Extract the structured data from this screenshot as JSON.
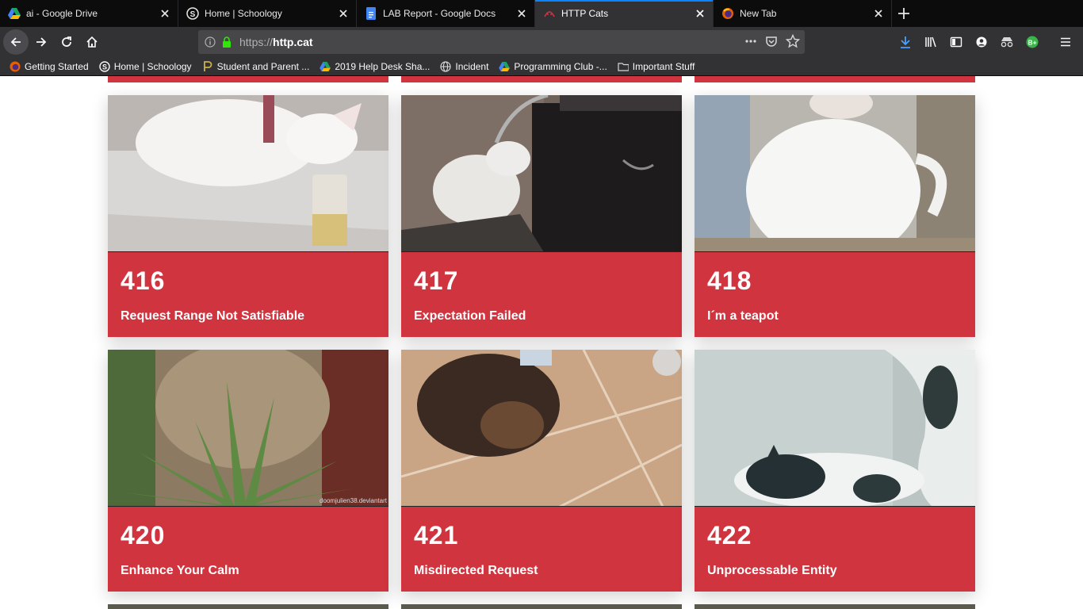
{
  "tabs": [
    {
      "title": "ai - Google Drive",
      "icon": "google-drive-icon"
    },
    {
      "title": "Home | Schoology",
      "icon": "schoology-icon"
    },
    {
      "title": "LAB Report - Google Docs",
      "icon": "google-docs-icon"
    },
    {
      "title": "HTTP Cats",
      "icon": "http-cats-icon",
      "active": true
    },
    {
      "title": "New Tab",
      "icon": "firefox-icon"
    }
  ],
  "urlbar": {
    "protocol": "https://",
    "host": "http.cat"
  },
  "bookmarks": [
    {
      "label": "Getting Started",
      "icon": "firefox-icon"
    },
    {
      "label": "Home | Schoology",
      "icon": "schoology-icon"
    },
    {
      "label": "Student and Parent ...",
      "icon": "p-logo-icon"
    },
    {
      "label": "2019 Help Desk Sha...",
      "icon": "google-drive-icon"
    },
    {
      "label": "Incident",
      "icon": "globe-icon"
    },
    {
      "label": "Programming Club -...",
      "icon": "google-drive-icon"
    },
    {
      "label": "Important Stuff",
      "icon": "folder-icon"
    }
  ],
  "cards": [
    {
      "code": "416",
      "desc": "Request Range Not Satisfiable"
    },
    {
      "code": "417",
      "desc": "Expectation Failed"
    },
    {
      "code": "418",
      "desc": "I´m a teapot"
    },
    {
      "code": "420",
      "desc": "Enhance Your Calm"
    },
    {
      "code": "421",
      "desc": "Misdirected Request"
    },
    {
      "code": "422",
      "desc": "Unprocessable Entity"
    }
  ],
  "colors": {
    "card_red": "#d0343f",
    "chrome_dark": "#0c0c0d",
    "chrome_toolbar": "#323234",
    "accent_blue": "#0a84ff"
  },
  "watermark": "doomjulien38.deviantart"
}
